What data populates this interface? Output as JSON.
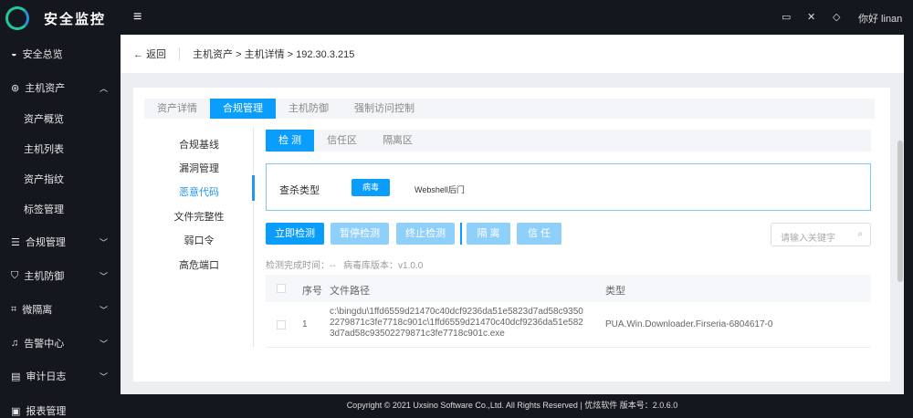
{
  "header": {
    "brand": "安全监控",
    "greeting": "你好 linan"
  },
  "sidebar": [
    {
      "label": "安全总览",
      "icon": "dashboard-icon"
    },
    {
      "label": "主机资产",
      "icon": "cube-icon",
      "expanded": true
    },
    {
      "label": "资产概览"
    },
    {
      "label": "主机列表"
    },
    {
      "label": "资产指纹"
    },
    {
      "label": "标签管理"
    },
    {
      "label": "合规管理",
      "icon": "list-icon"
    },
    {
      "label": "主机防御",
      "icon": "shield-icon"
    },
    {
      "label": "微隔离",
      "icon": "bracket-icon"
    },
    {
      "label": "告警中心",
      "icon": "bell-icon"
    },
    {
      "label": "审计日志",
      "icon": "log-icon"
    },
    {
      "label": "报表管理",
      "icon": "report-icon"
    }
  ],
  "breadcrumb": {
    "back": "返回",
    "path": "主机资产 > 主机详情 > 192.30.3.215"
  },
  "tabs": [
    "资产详情",
    "合规管理",
    "主机防御",
    "强制访问控制"
  ],
  "leftnav": [
    "合规基线",
    "漏洞管理",
    "恶意代码",
    "文件完整性",
    "弱口令",
    "高危端口"
  ],
  "subtabs": [
    "检 测",
    "信任区",
    "隔离区"
  ],
  "filter": {
    "label": "查杀类型",
    "options": [
      "病毒",
      "Webshell后门"
    ]
  },
  "actions": [
    "立即检测",
    "暂停检测",
    "终止检测",
    "隔 离",
    "信 任"
  ],
  "search_placeholder": "请输入关键字",
  "info": {
    "time": "检测完成时间：--",
    "version": "病毒库版本：v1.0.0"
  },
  "table": {
    "headers": [
      "序号",
      "文件路径",
      "类型"
    ],
    "rows": [
      {
        "no": "1",
        "path": "c:\\bingdu\\1ffd6559d21470c40dcf9236da51e5823d7ad58c93502279871c3fe7718c901c\\1ffd6559d21470c40dcf9236da51e5823d7ad58c93502279871c3fe7718c901c.exe",
        "type": "PUA.Win.Downloader.Firseria-6804617-0"
      }
    ]
  },
  "footer": "Copyright © 2021 Uxsino Software Co.,Ltd. All Rights Reserved | 优炫软件 版本号：2.0.6.0"
}
